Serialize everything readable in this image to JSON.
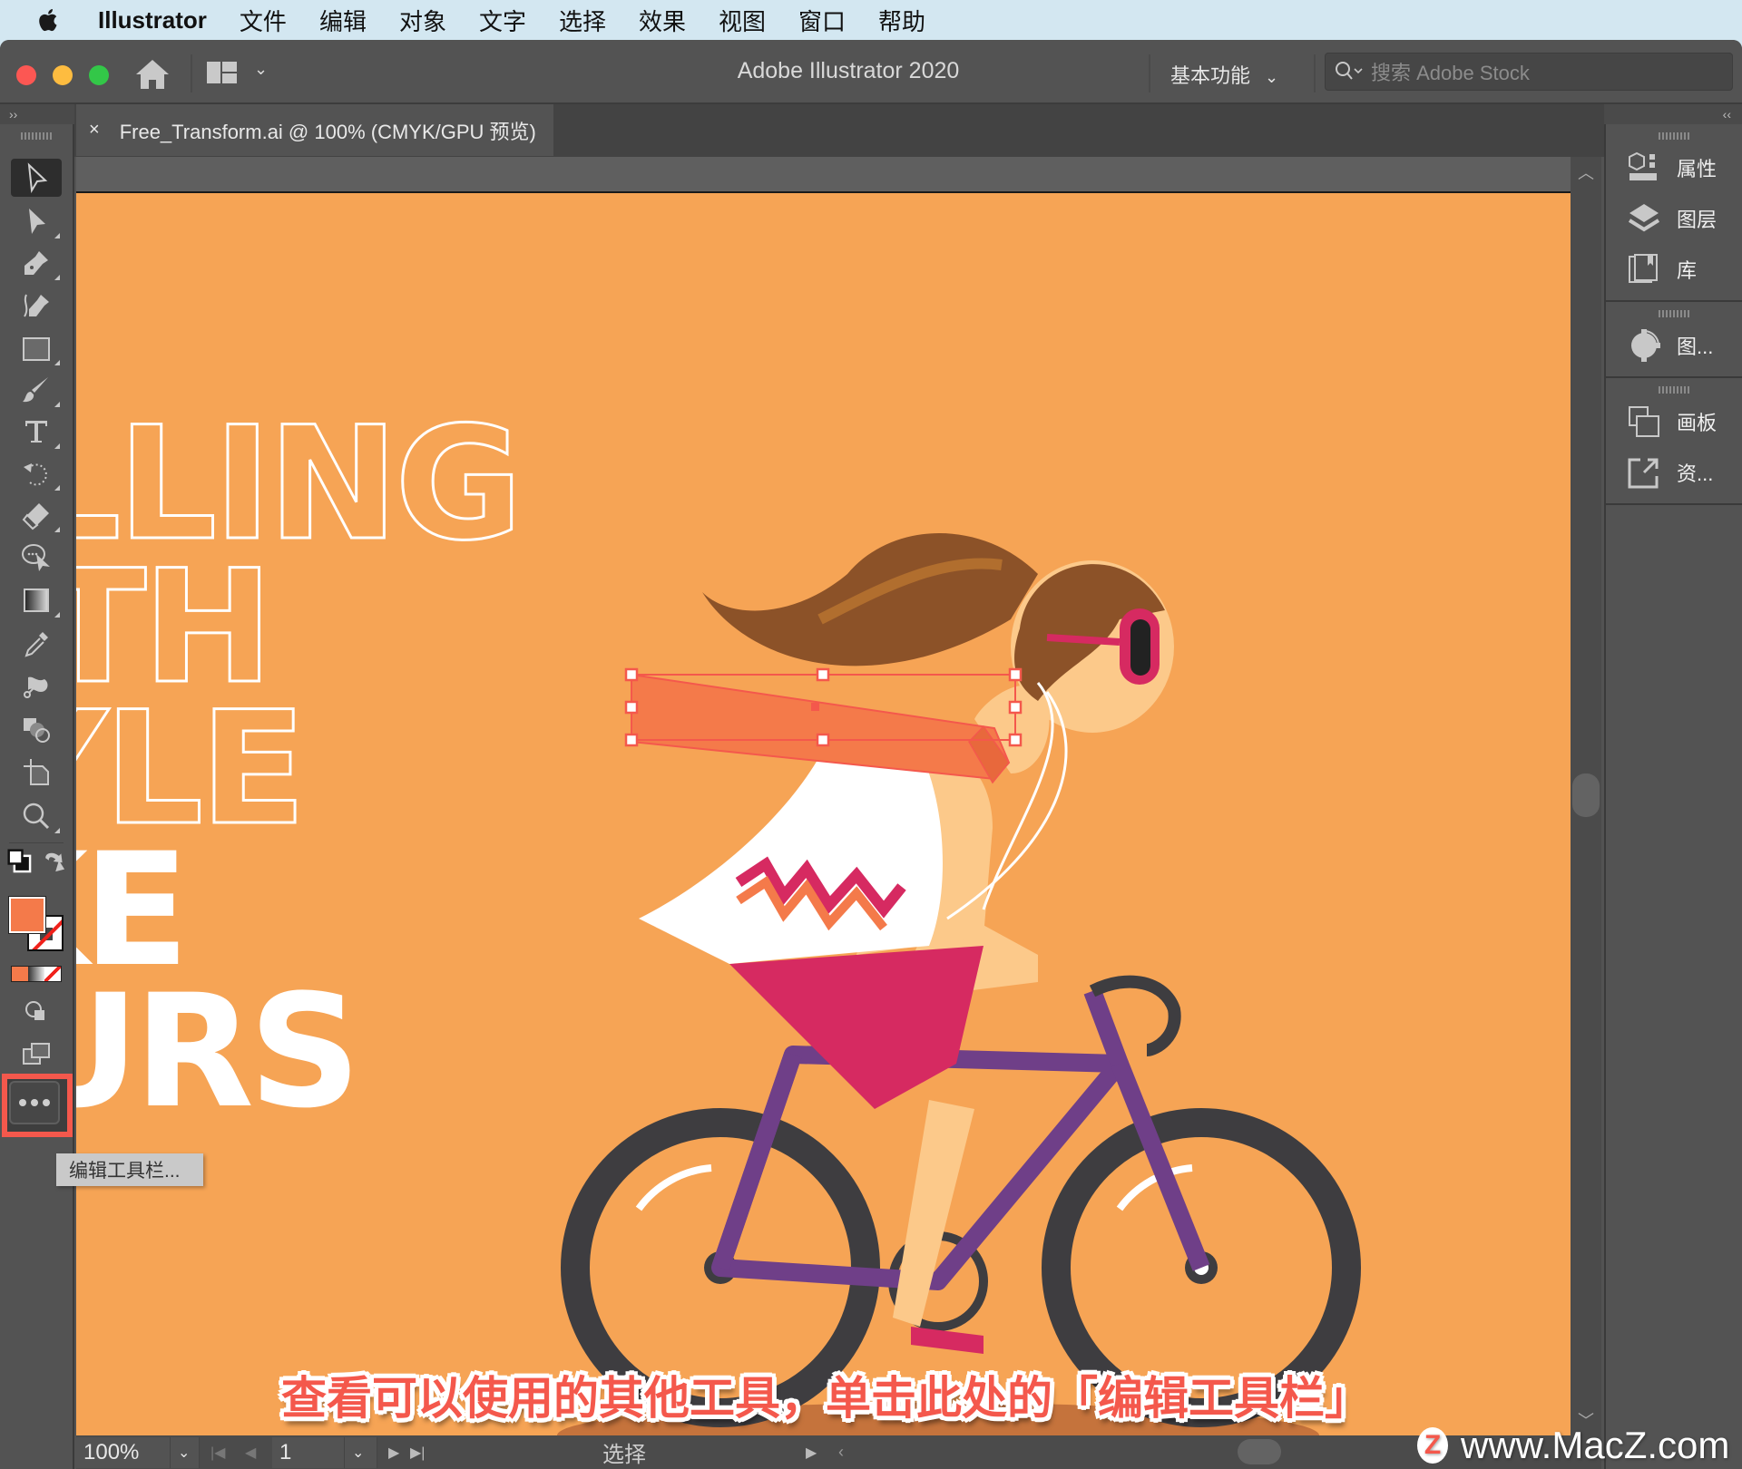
{
  "menubar": {
    "app_name": "Illustrator",
    "items": [
      "文件",
      "编辑",
      "对象",
      "文字",
      "选择",
      "效果",
      "视图",
      "窗口",
      "帮助"
    ]
  },
  "titlebar": {
    "title": "Adobe Illustrator 2020",
    "workspace": "基本功能",
    "search_placeholder": "搜索 Adobe Stock",
    "colors": {
      "close": "#fc5753",
      "minimize": "#fdbc40",
      "zoom": "#33c748"
    }
  },
  "document_tab": {
    "close_glyph": "×",
    "title": "Free_Transform.ai @ 100% (CMYK/GPU 预览)"
  },
  "toolbar": {
    "tools": [
      {
        "name": "selection-tool",
        "active": true
      },
      {
        "name": "direct-selection-tool"
      },
      {
        "name": "pen-tool"
      },
      {
        "name": "curvature-tool"
      },
      {
        "name": "rectangle-tool"
      },
      {
        "name": "paintbrush-tool"
      },
      {
        "name": "type-tool"
      },
      {
        "name": "rotate-tool"
      },
      {
        "name": "eraser-tool"
      },
      {
        "name": "puppet-warp-tool"
      },
      {
        "name": "gradient-tool"
      },
      {
        "name": "eyedropper-tool"
      },
      {
        "name": "symbol-sprayer-tool"
      },
      {
        "name": "shape-builder-tool"
      },
      {
        "name": "artboard-tool"
      },
      {
        "name": "zoom-tool"
      }
    ],
    "fill_color": "#f47a4a",
    "stroke": "none",
    "edit_toolbar_label": "•••",
    "tooltip": "编辑工具栏..."
  },
  "right_panel": {
    "groups": [
      [
        {
          "icon": "properties-icon",
          "label": "属性"
        },
        {
          "icon": "layers-icon",
          "label": "图层"
        },
        {
          "icon": "libraries-icon",
          "label": "库"
        }
      ],
      [
        {
          "icon": "recolor-icon",
          "label": "图..."
        }
      ],
      [
        {
          "icon": "artboards-icon",
          "label": "画板"
        },
        {
          "icon": "asset-export-icon",
          "label": "资..."
        }
      ]
    ]
  },
  "artwork": {
    "background": "#f6a455",
    "outline_lines": [
      "LLING",
      "TH",
      "YLE"
    ],
    "solid_lines": [
      "KE",
      "URS"
    ]
  },
  "statusbar": {
    "zoom": "100%",
    "artboard_number": "1",
    "tool_name": "选择"
  },
  "caption": "查看可以使用的其他工具，单击此处的「编辑工具栏」",
  "watermark": "www.MacZ.com"
}
